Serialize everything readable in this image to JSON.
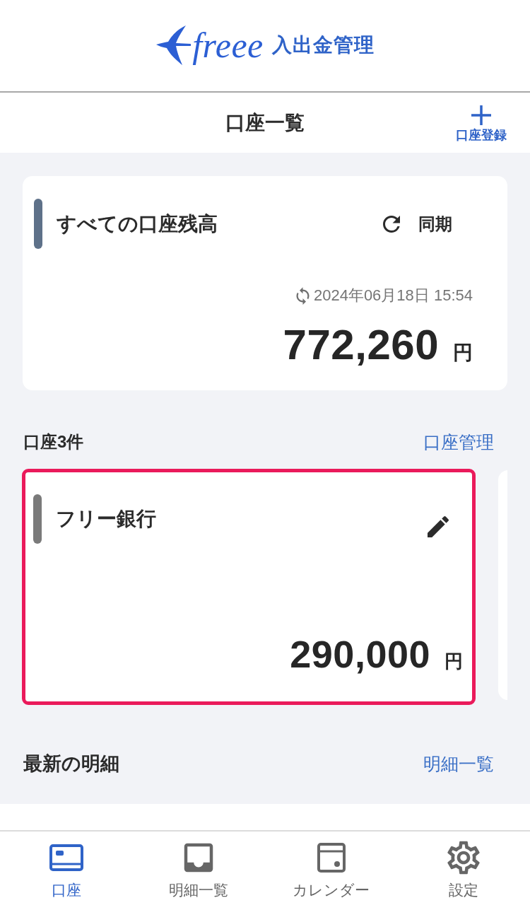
{
  "header": {
    "logo": {
      "brand": "freee",
      "product": "入出金管理"
    }
  },
  "title_bar": {
    "title": "口座一覧",
    "add_button": {
      "label": "口座登録"
    }
  },
  "summary": {
    "title": "すべての口座残高",
    "sync_button": {
      "label": "同期"
    },
    "updated_at": "2024年06月18日 15:54",
    "amount": "772,260",
    "currency": "円"
  },
  "accounts_section": {
    "heading": "口座3件",
    "link": "口座管理",
    "accounts": [
      {
        "name": "フリー銀行",
        "amount": "290,000",
        "currency": "円",
        "selected": true,
        "color": "#7a7a7a"
      }
    ]
  },
  "statements_section": {
    "heading": "最新の明細",
    "link": "明細一覧"
  },
  "tab_bar": {
    "tabs": [
      {
        "kind": "accounts",
        "label": "口座",
        "selected": true
      },
      {
        "kind": "statements",
        "label": "明細一覧",
        "selected": false
      },
      {
        "kind": "calendar",
        "label": "カレンダー",
        "selected": false
      },
      {
        "kind": "settings",
        "label": "設定",
        "selected": false
      }
    ]
  }
}
